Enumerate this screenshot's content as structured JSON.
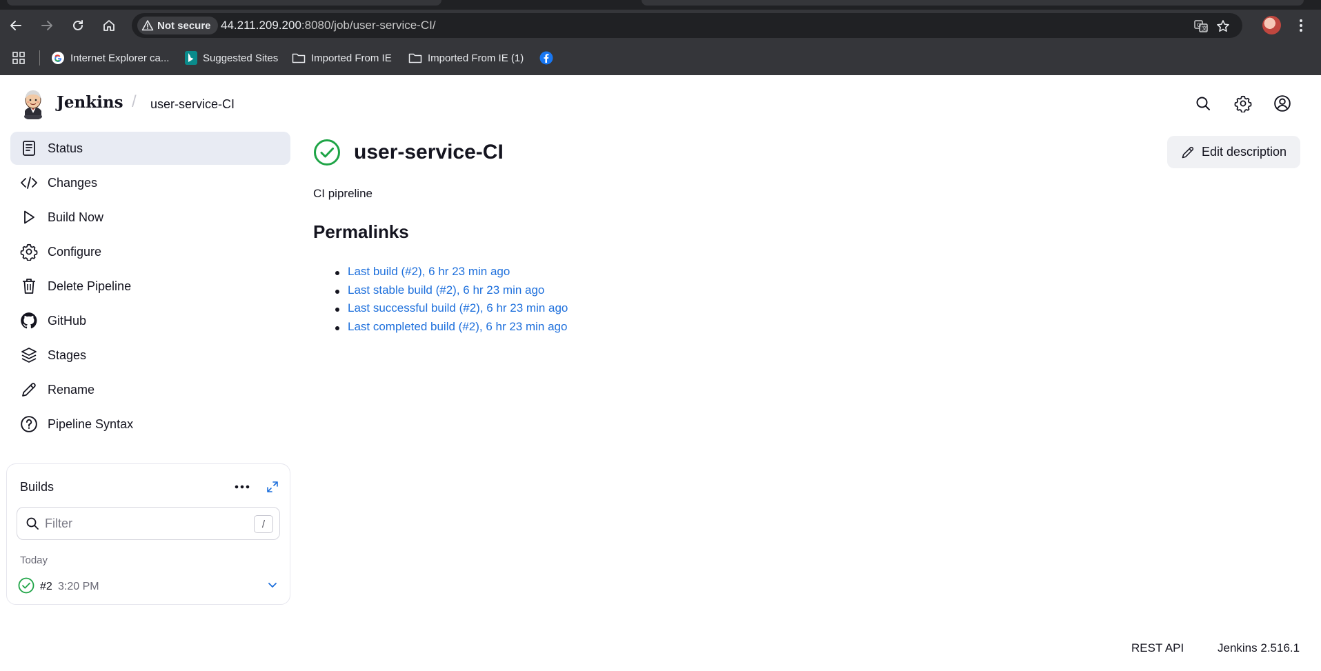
{
  "browser": {
    "security_label": "Not secure",
    "url_host": "44.211.209.200",
    "url_path": ":8080/job/user-service-CI/",
    "bookmarks": [
      {
        "label": "Internet Explorer ca...",
        "icon": "google-icon"
      },
      {
        "label": "Suggested Sites",
        "icon": "bing-icon"
      },
      {
        "label": "Imported From IE",
        "icon": "folder-icon"
      },
      {
        "label": "Imported From IE (1)",
        "icon": "folder-icon"
      }
    ]
  },
  "header": {
    "brand": "Jenkins",
    "breadcrumb_separator": "/",
    "breadcrumb_job": "user-service-CI"
  },
  "sidebar": {
    "items": [
      {
        "label": "Status",
        "icon": "document-icon",
        "active": true
      },
      {
        "label": "Changes",
        "icon": "code-icon"
      },
      {
        "label": "Build Now",
        "icon": "play-icon"
      },
      {
        "label": "Configure",
        "icon": "gear-icon"
      },
      {
        "label": "Delete Pipeline",
        "icon": "trash-icon"
      },
      {
        "label": "GitHub",
        "icon": "github-icon"
      },
      {
        "label": "Stages",
        "icon": "layers-icon"
      },
      {
        "label": "Rename",
        "icon": "pencil-icon"
      },
      {
        "label": "Pipeline Syntax",
        "icon": "help-icon"
      }
    ]
  },
  "builds": {
    "title": "Builds",
    "filter_placeholder": "Filter",
    "filter_shortcut": "/",
    "group_label": "Today",
    "items": [
      {
        "number": "#2",
        "time": "3:20 PM",
        "status": "success"
      }
    ]
  },
  "main": {
    "title": "user-service-CI",
    "status": "success",
    "edit_label": "Edit description",
    "description": "CI pipreline",
    "permalinks_heading": "Permalinks",
    "permalinks": [
      "Last build (#2), 6 hr 23 min ago",
      "Last stable build (#2), 6 hr 23 min ago",
      "Last successful build (#2), 6 hr 23 min ago",
      "Last completed build (#2), 6 hr 23 min ago"
    ]
  },
  "footer": {
    "rest_api": "REST API",
    "version": "Jenkins 2.516.1"
  },
  "colors": {
    "success": "#1ea446",
    "link": "#1d6fdc",
    "active_bg": "#e8ebf3"
  }
}
